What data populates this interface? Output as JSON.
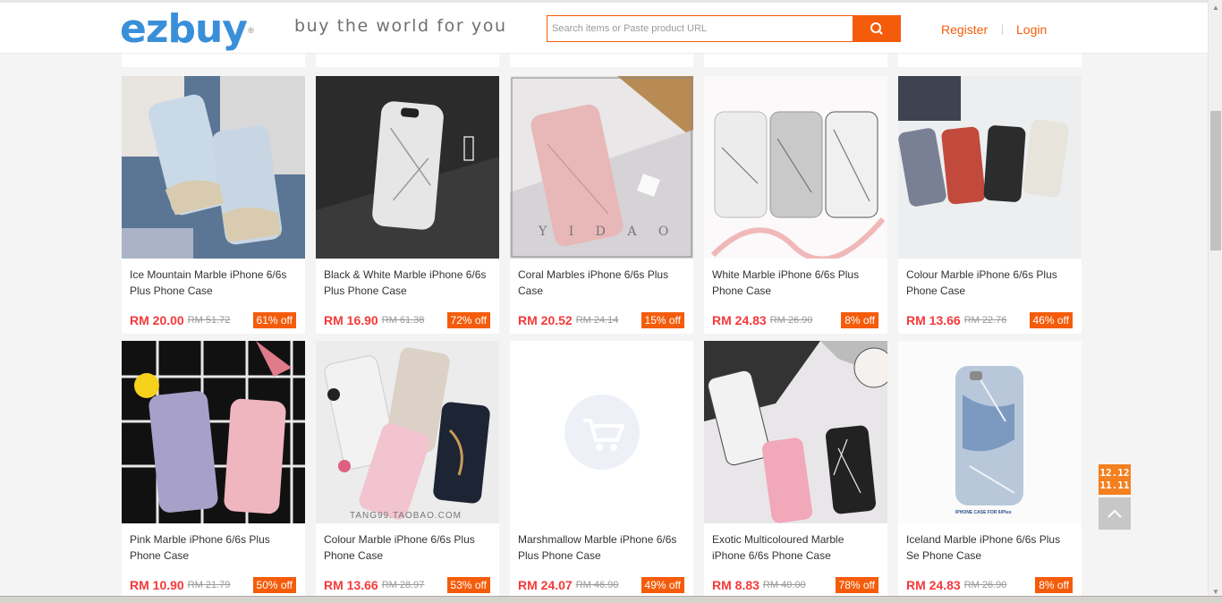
{
  "header": {
    "logo_text": "ezbuy",
    "logo_mark": "®",
    "slogan": "buy the world for you",
    "search_placeholder": "Search items or Paste product URL",
    "register_label": "Register",
    "separator": "|",
    "login_label": "Login"
  },
  "products": [
    {
      "title": "Ice Mountain Marble iPhone 6/6s Plus Phone Case",
      "price": "RM 20.00",
      "original_price": "RM 51.72",
      "discount": "61% off"
    },
    {
      "title": "Black & White Marble iPhone 6/6s Plus Phone Case",
      "price": "RM 16.90",
      "original_price": "RM 61.38",
      "discount": "72% off"
    },
    {
      "title": "Coral Marbles iPhone 6/6s Plus Case",
      "price": "RM 20.52",
      "original_price": "RM 24.14",
      "discount": "15% off"
    },
    {
      "title": "White Marble iPhone 6/6s Plus Phone Case",
      "price": "RM 24.83",
      "original_price": "RM 26.90",
      "discount": "8% off"
    },
    {
      "title": "Colour Marble iPhone 6/6s Plus Phone Case",
      "price": "RM 13.66",
      "original_price": "RM 22.76",
      "discount": "46% off"
    },
    {
      "title": "Pink Marble iPhone 6/6s Plus Phone Case",
      "price": "RM 10.90",
      "original_price": "RM 21.79",
      "discount": "50% off"
    },
    {
      "title": "Colour Marble iPhone 6/6s Plus Phone Case",
      "price": "RM 13.66",
      "original_price": "RM 28.97",
      "discount": "53% off"
    },
    {
      "title": "Marshmallow Marble iPhone 6/6s Plus Phone Case",
      "price": "RM 24.07",
      "original_price": "RM 46.90",
      "discount": "49% off"
    },
    {
      "title": "Exotic Multicoloured Marble iPhone 6/6s Phone Case",
      "price": "RM 8.83",
      "original_price": "RM 40.00",
      "discount": "78% off"
    },
    {
      "title": "Iceland Marble iPhone 6/6s Plus Se Phone Case",
      "price": "RM 24.83",
      "original_price": "RM 26.90",
      "discount": "8% off"
    }
  ],
  "image_text": {
    "coral_watermark": "Y I D A O",
    "colour_watermark": "TANG99.TAOBAO.COM",
    "iceland_caption": "IPHONE CASE FOR 6/Plus"
  },
  "promo": {
    "line1": "12.12",
    "line2": "11.11"
  },
  "colors": {
    "accent": "#f45c0b",
    "price": "#f43a3a",
    "logo": "#3a8fd9"
  },
  "icons": [
    "search-icon",
    "back-to-top-icon",
    "cart-placeholder-icon"
  ]
}
